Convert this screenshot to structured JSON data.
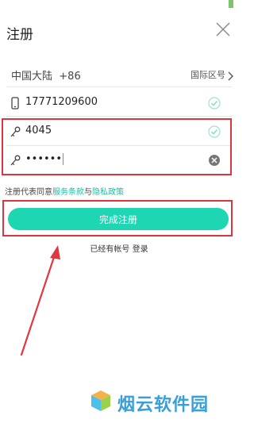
{
  "header": {
    "title": "注册"
  },
  "region": {
    "name": "中国大陆",
    "code": "+86",
    "selector_label": "国际区号"
  },
  "fields": {
    "phone": "17771209600",
    "code": "4045",
    "password": "••••••"
  },
  "agreement": {
    "prefix": "注册代表同意",
    "terms": "服务条款",
    "and": "与",
    "privacy": "隐私政策"
  },
  "actions": {
    "submit_label": "完成注册",
    "login_prompt": "已经有帐号",
    "login_link": "登录"
  },
  "watermark": {
    "text": "烟云软件园"
  },
  "colors": {
    "accent": "#1fd6b3",
    "link": "#19c1a6",
    "highlight": "#d9363e",
    "check": "#7fd9c6"
  }
}
